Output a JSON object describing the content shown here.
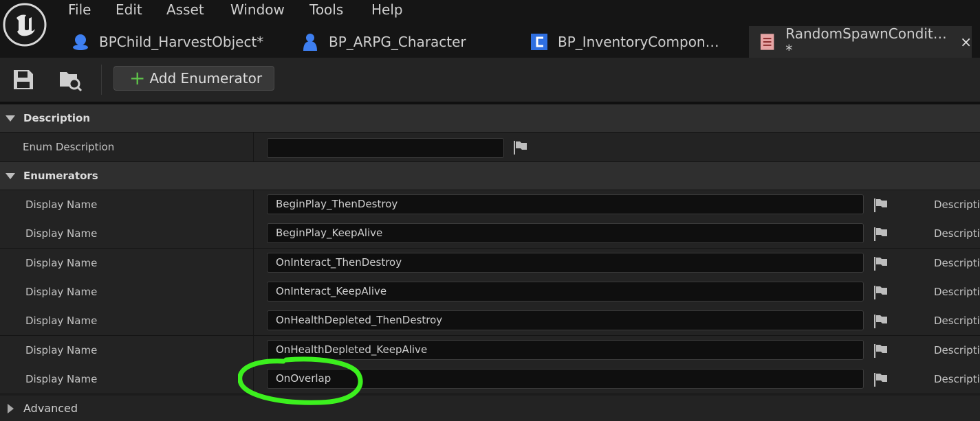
{
  "menu": [
    "File",
    "Edit",
    "Asset",
    "Window",
    "Tools",
    "Help"
  ],
  "tabs": [
    {
      "label": "BPChild_HarvestObject*",
      "icon": "blueprint-actor-icon"
    },
    {
      "label": "BP_ARPG_Character",
      "icon": "character-blueprint-icon"
    },
    {
      "label": "BP_InventoryCompon…",
      "icon": "component-blueprint-icon"
    },
    {
      "label": "RandomSpawnCondit… *",
      "icon": "enum-asset-icon",
      "active": true,
      "close": "×"
    }
  ],
  "toolbar": {
    "add_label": "Add Enumerator",
    "add_plus": "+"
  },
  "sections": {
    "description": "Description",
    "enumerators": "Enumerators",
    "advanced": "Advanced"
  },
  "description_row": {
    "label": "Enum Description",
    "value": ""
  },
  "enumerators": [
    {
      "label": "Display Name",
      "value": "BeginPlay_ThenDestroy",
      "desc": "Descripti"
    },
    {
      "label": "Display Name",
      "value": "BeginPlay_KeepAlive",
      "desc": "Descripti"
    },
    {
      "label": "Display Name",
      "value": "OnInteract_ThenDestroy",
      "desc": "Descripti"
    },
    {
      "label": "Display Name",
      "value": "OnInteract_KeepAlive",
      "desc": "Descripti"
    },
    {
      "label": "Display Name",
      "value": "OnHealthDepleted_ThenDestroy",
      "desc": "Descripti"
    },
    {
      "label": "Display Name",
      "value": "OnHealthDepleted_KeepAlive",
      "desc": "Descripti"
    },
    {
      "label": "Display Name",
      "value": "OnOverlap",
      "desc": "Descripti"
    }
  ],
  "colors": {
    "accent_add": "#5fc44a",
    "highlight_circle": "#3cf01e",
    "tab_blue": "#2f6fe0"
  }
}
